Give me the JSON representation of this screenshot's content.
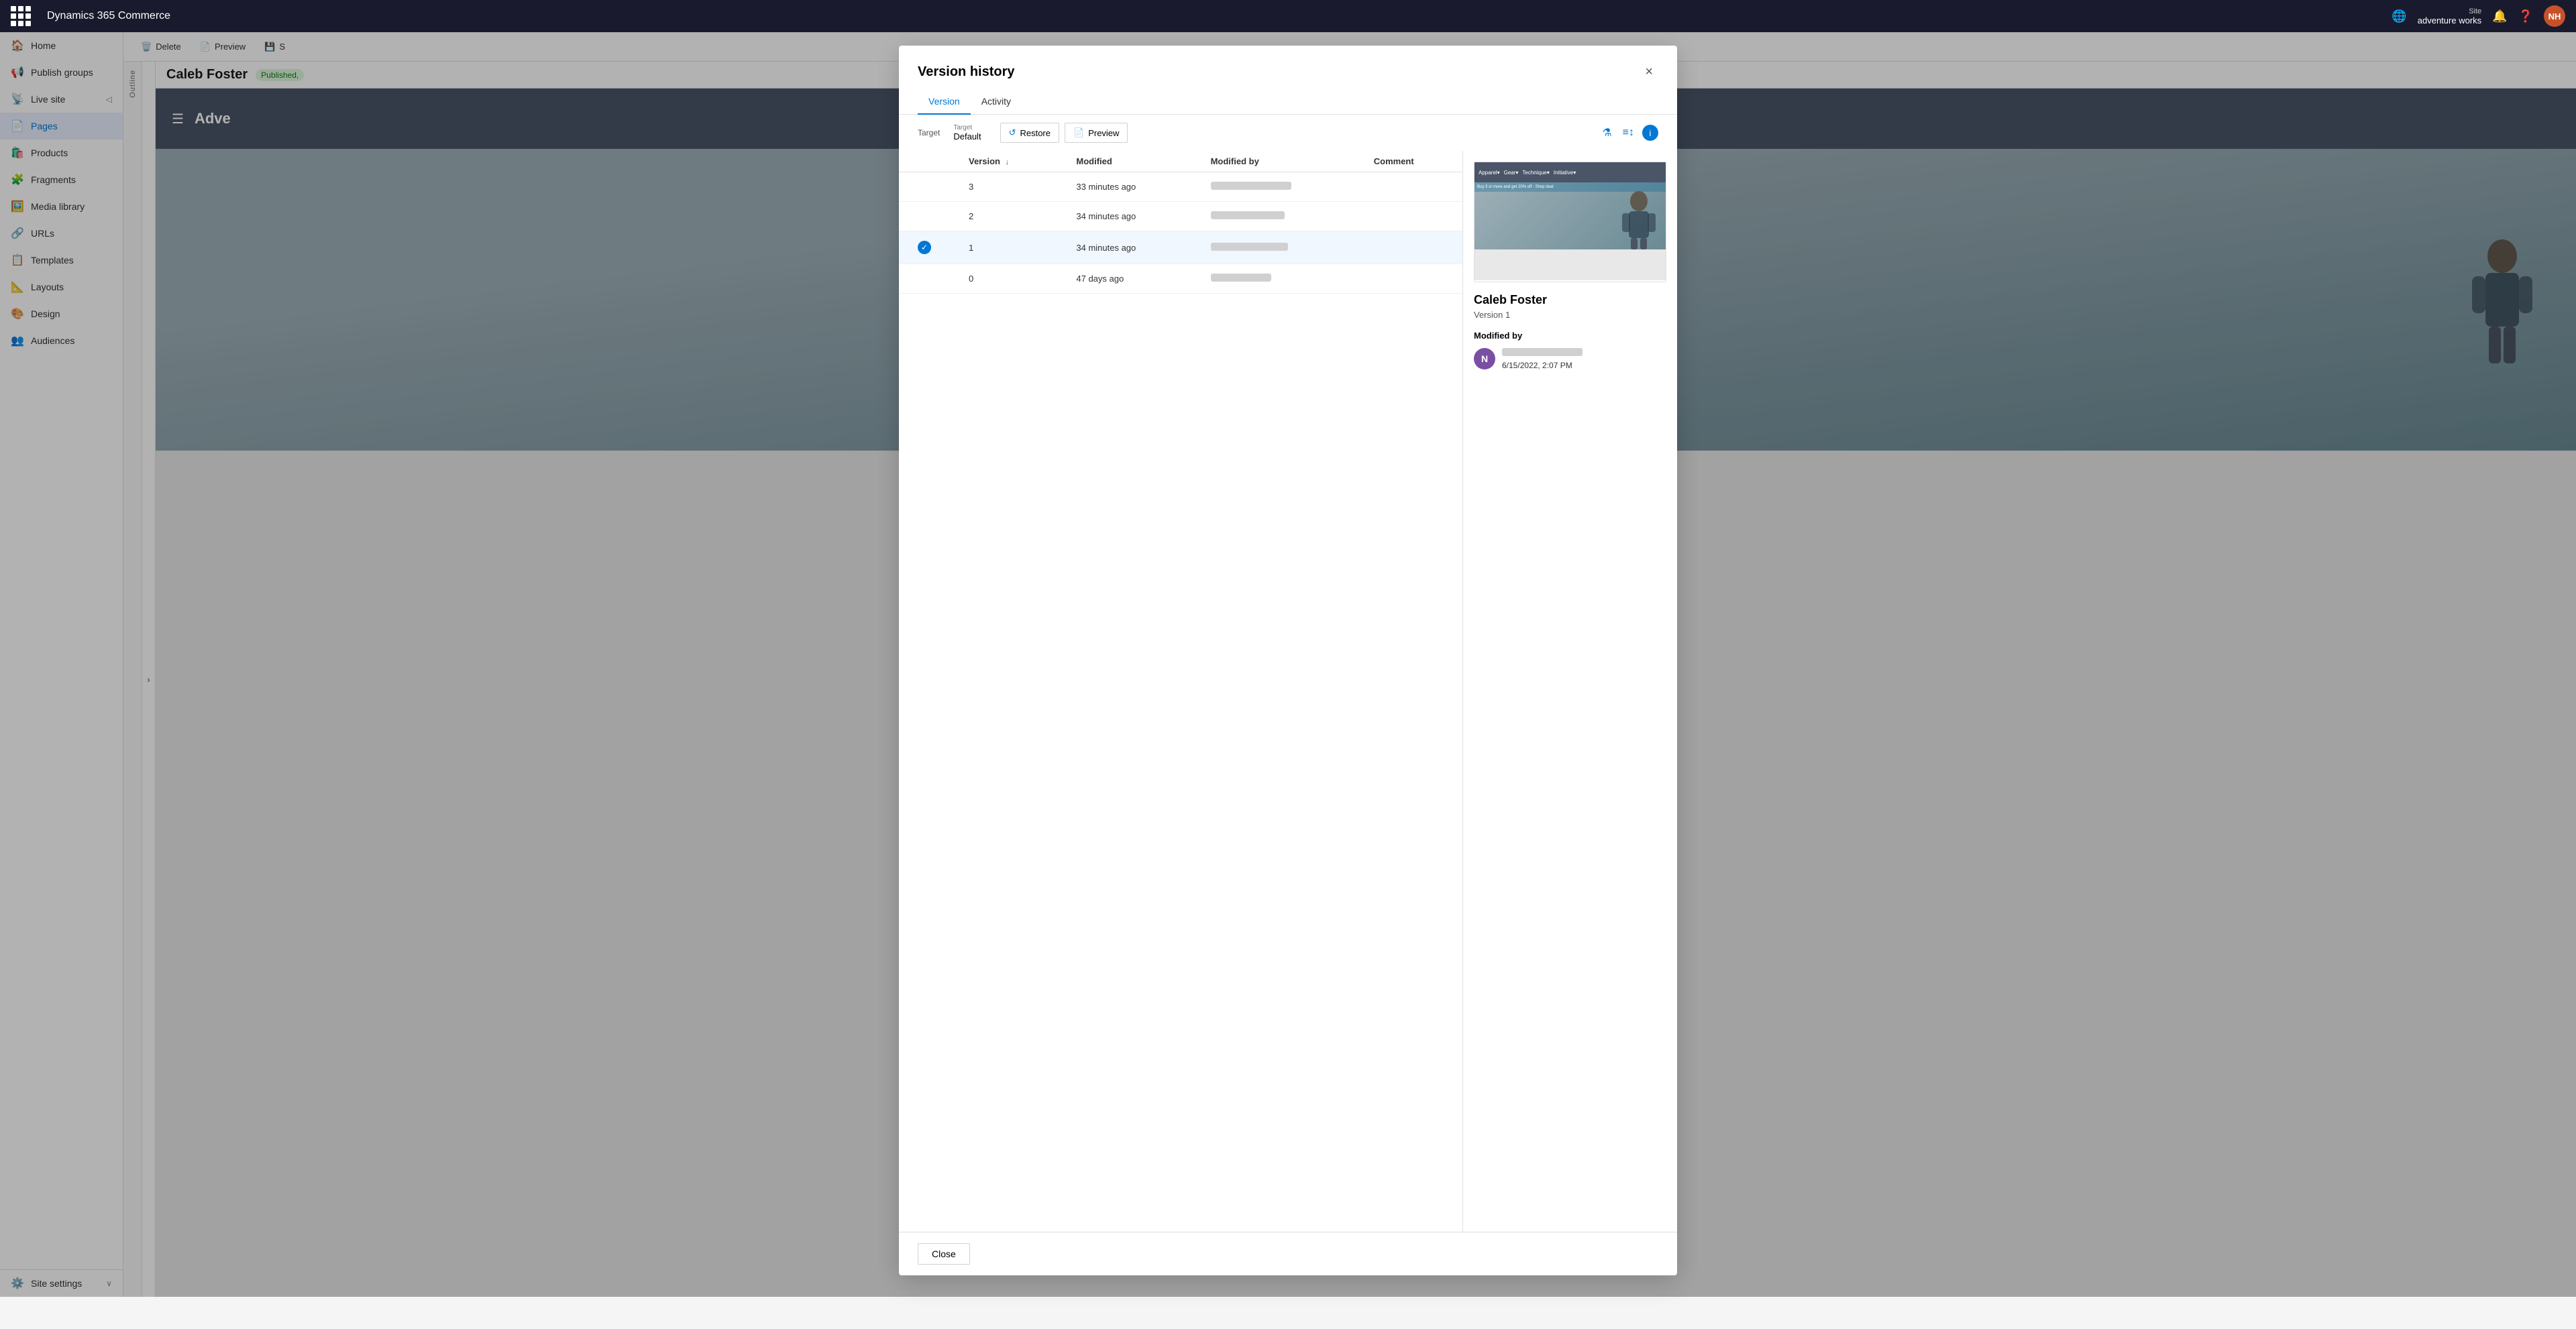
{
  "app": {
    "title": "Dynamics 365 Commerce"
  },
  "topnav": {
    "site_label": "Site",
    "site_name": "adventure works",
    "avatar_initials": "NH",
    "avatar_bg": "#c7522a"
  },
  "sidebar": {
    "items": [
      {
        "id": "home",
        "label": "Home",
        "icon": "🏠"
      },
      {
        "id": "publish-groups",
        "label": "Publish groups",
        "icon": "📢"
      },
      {
        "id": "live-site",
        "label": "Live site",
        "icon": "📡",
        "has_chevron": true
      },
      {
        "id": "pages",
        "label": "Pages",
        "icon": "📄",
        "active": true
      },
      {
        "id": "products",
        "label": "Products",
        "icon": "🛍️"
      },
      {
        "id": "fragments",
        "label": "Fragments",
        "icon": "🧩"
      },
      {
        "id": "media-library",
        "label": "Media library",
        "icon": "🖼️"
      },
      {
        "id": "urls",
        "label": "URLs",
        "icon": "🔗"
      },
      {
        "id": "templates",
        "label": "Templates",
        "icon": "📋"
      },
      {
        "id": "layouts",
        "label": "Layouts",
        "icon": "📐"
      },
      {
        "id": "design",
        "label": "Design",
        "icon": "🎨"
      },
      {
        "id": "audiences",
        "label": "Audiences",
        "icon": "👥"
      }
    ],
    "bottom": {
      "label": "Site settings",
      "icon": "⚙️"
    }
  },
  "toolbar": {
    "delete_label": "Delete",
    "preview_label": "Preview",
    "save_label": "Save"
  },
  "page": {
    "title": "Caleb Foster",
    "status": "Published,"
  },
  "outline": {
    "label": "Outline"
  },
  "modal": {
    "title": "Version history",
    "close_label": "×",
    "tabs": [
      "Version",
      "Activity"
    ],
    "active_tab": "Version",
    "target_label": "Target",
    "target_value": "Default",
    "restore_label": "Restore",
    "preview_label": "Preview",
    "table": {
      "columns": [
        "Version",
        "Modified",
        "Modified by",
        "Comment"
      ],
      "rows": [
        {
          "version": "3",
          "modified": "33 minutes ago",
          "author_width": 120,
          "selected": false,
          "checked": false
        },
        {
          "version": "2",
          "modified": "34 minutes ago",
          "author_width": 110,
          "selected": false,
          "checked": false
        },
        {
          "version": "1",
          "modified": "34 minutes ago",
          "author_width": 115,
          "selected": true,
          "checked": true
        },
        {
          "version": "0",
          "modified": "47 days ago",
          "author_width": 90,
          "selected": false,
          "checked": false
        }
      ]
    },
    "preview": {
      "page_name": "Caleb Foster",
      "version_label": "Version 1",
      "modified_by_label": "Modified by",
      "avatar_initial": "N",
      "avatar_bg": "#7a4fa3",
      "author_bar_width": 120,
      "date": "6/15/2022, 2:07 PM"
    },
    "close_button": "Close"
  }
}
